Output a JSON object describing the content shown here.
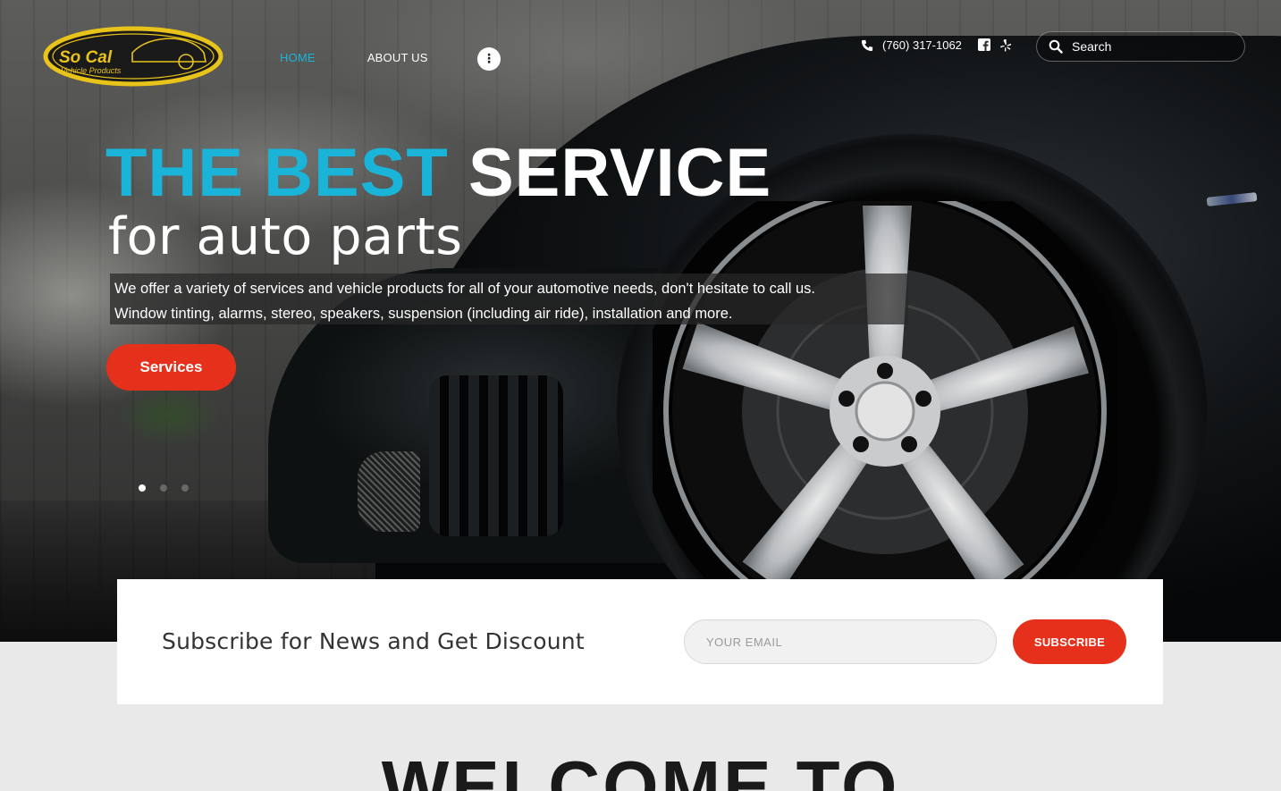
{
  "brand": {
    "logo_line1": "So Cal",
    "logo_line2": "Vehicle Products"
  },
  "nav": {
    "items": [
      {
        "label": "HOME",
        "active": true
      },
      {
        "label": "ABOUT US",
        "active": false
      }
    ],
    "more_label": "⋮"
  },
  "contact": {
    "phone": "(760) 317-1062"
  },
  "search": {
    "placeholder": "Search"
  },
  "hero": {
    "headline_accent": "THE BEST",
    "headline_main": "SERVICE",
    "subheadline": "for auto parts",
    "description_line1": "We offer a variety of services and vehicle products for all of your automotive needs, don't hesitate to call us.",
    "description_line2": "Window tinting, alarms, stereo, speakers, suspension (including air ride), installation and more.",
    "cta_label": "Services",
    "slides_total": 3,
    "slide_active": 1
  },
  "subscribe": {
    "title": "Subscribe for News and Get Discount",
    "email_placeholder": "YOUR EMAIL",
    "button_label": "SUBSCRIBE"
  },
  "welcome": {
    "title": "WELCOME TO"
  },
  "colors": {
    "accent": "#1bb4d9",
    "cta": "#e5311b",
    "logo_gold": "#e8c31a",
    "page_bg": "#e9e9e9"
  }
}
